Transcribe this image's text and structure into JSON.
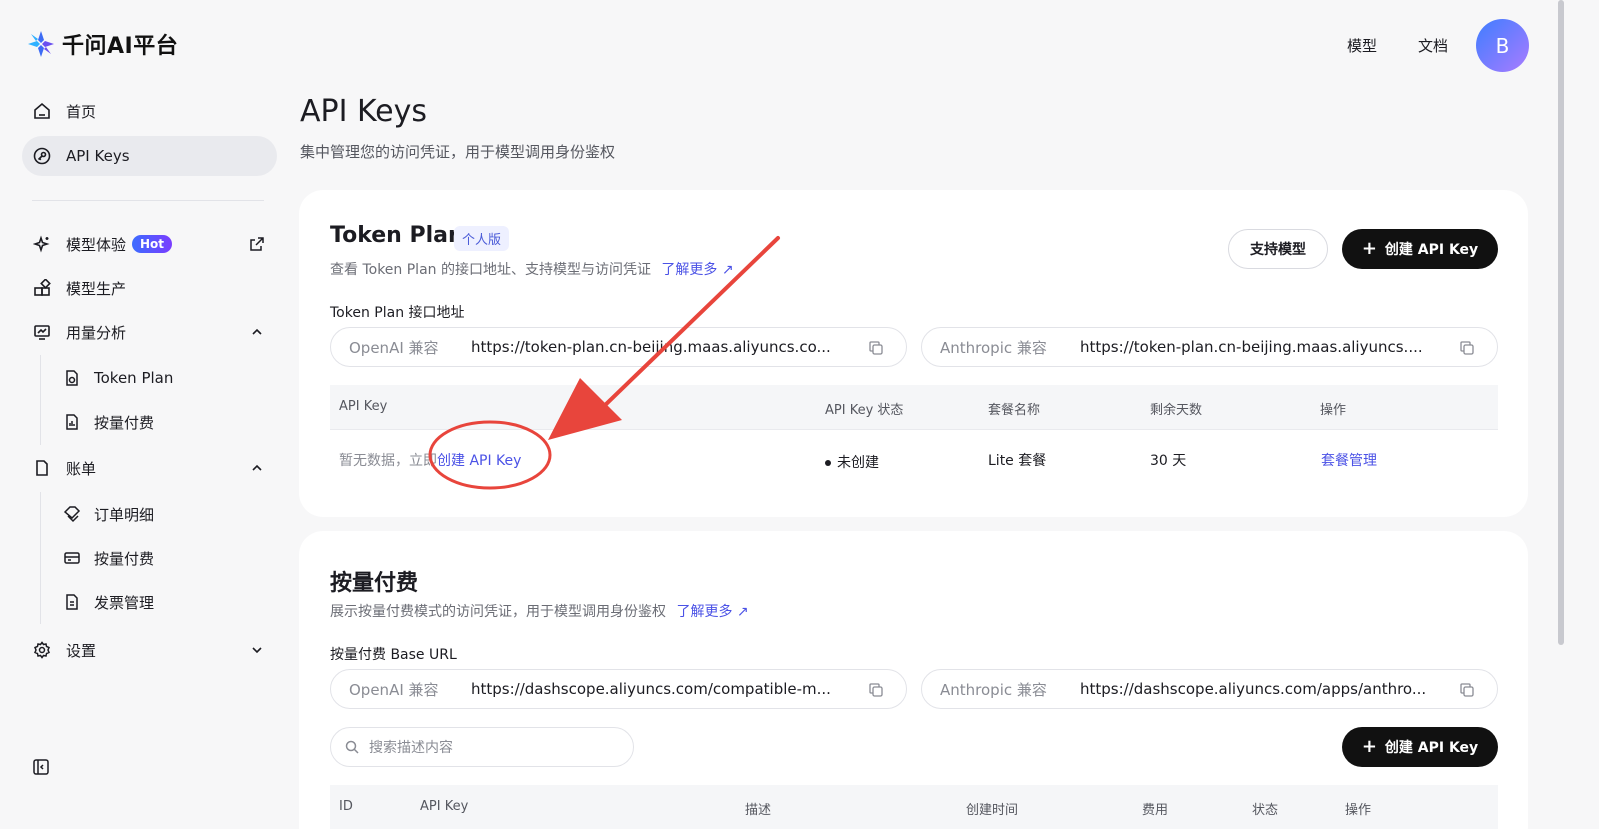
{
  "brand": {
    "name": "千问AI平台"
  },
  "header": {
    "links": [
      "模型",
      "文档"
    ],
    "avatar_letter": "B"
  },
  "sidebar": {
    "items": [
      {
        "label": "首页",
        "icon": "home-icon"
      },
      {
        "label": "API Keys",
        "icon": "key-icon",
        "active": true
      },
      {
        "label": "模型体验",
        "icon": "sparkle-icon",
        "badge": "Hot",
        "trailing": "external-link-icon"
      },
      {
        "label": "模型生产",
        "icon": "blocks-icon"
      },
      {
        "label": "用量分析",
        "icon": "chart-monitor-icon",
        "expanded": true,
        "children": [
          {
            "label": "Token Plan",
            "icon": "token-doc-icon"
          },
          {
            "label": "按量付费",
            "icon": "bill-doc-icon"
          }
        ]
      },
      {
        "label": "账单",
        "icon": "document-icon",
        "expanded": true,
        "children": [
          {
            "label": "订单明细",
            "icon": "tags-icon"
          },
          {
            "label": "按量付费",
            "icon": "card-icon"
          },
          {
            "label": "发票管理",
            "icon": "invoice-icon"
          }
        ]
      },
      {
        "label": "设置",
        "icon": "gear-icon",
        "expanded": false
      }
    ]
  },
  "page": {
    "title": "API Keys",
    "subtitle": "集中管理您的访问凭证，用于模型调用身份鉴权"
  },
  "token_plan": {
    "title": "Token Plan",
    "tag": "个人版",
    "desc": "查看 Token Plan 的接口地址、支持模型与访问凭证",
    "learn_more": "了解更多",
    "btn_models": "支持模型",
    "btn_create": "创建 API Key",
    "endpoint_label": "Token Plan 接口地址",
    "openai_label": "OpenAI 兼容",
    "openai_url": "https://token-plan.cn-beijing.maas.aliyuncs.co...",
    "anthropic_label": "Anthropic 兼容",
    "anthropic_url": "https://token-plan.cn-beijing.maas.aliyuncs....",
    "columns": [
      "API Key",
      "API Key 状态",
      "套餐名称",
      "剩余天数",
      "操作"
    ],
    "row": {
      "empty_prefix": "暂无数据，立即",
      "empty_link": "创建 API Key",
      "status": "未创建",
      "plan": "Lite 套餐",
      "days": "30 天",
      "action": "套餐管理"
    }
  },
  "payg": {
    "title": "按量付费",
    "desc": "展示按量付费模式的访问凭证，用于模型调用身份鉴权",
    "learn_more": "了解更多",
    "endpoint_label": "按量付费 Base URL",
    "openai_label": "OpenAI 兼容",
    "openai_url": "https://dashscope.aliyuncs.com/compatible-m...",
    "anthropic_label": "Anthropic 兼容",
    "anthropic_url": "https://dashscope.aliyuncs.com/apps/anthro...",
    "search_placeholder": "搜索描述内容",
    "btn_create": "创建 API Key",
    "columns": [
      "ID",
      "API Key",
      "描述",
      "创建时间",
      "费用",
      "状态",
      "操作"
    ]
  },
  "colors": {
    "accent": "#4b52e6",
    "annotation": "#e8453c"
  }
}
